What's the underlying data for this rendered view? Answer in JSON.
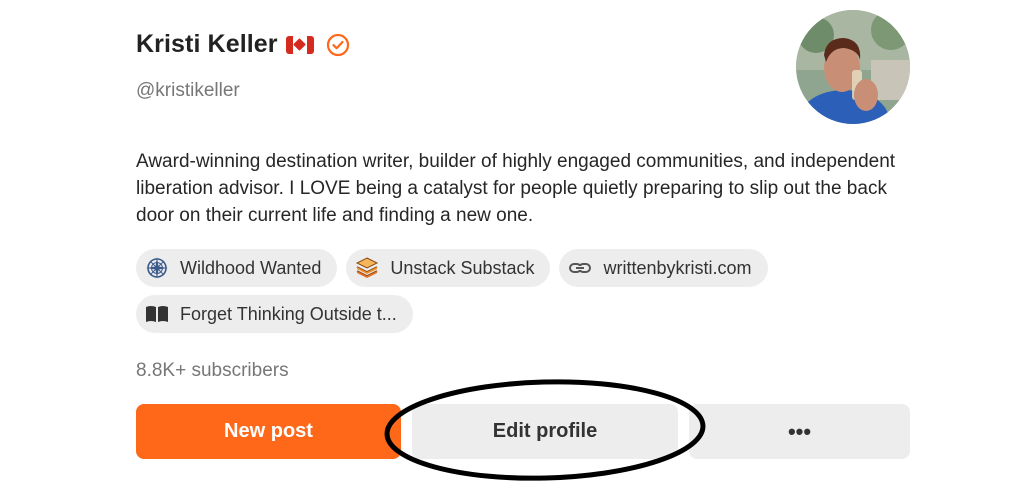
{
  "profile": {
    "name": "Kristi Keller",
    "flag": "🇨🇦",
    "handle": "@kristikeller",
    "bio": "Award-winning destination writer, builder of highly engaged communities, and independent liberation advisor. I LOVE being a catalyst for people quietly preparing to slip out the back door on their current life and finding a new one.",
    "subscribers": "8.8K+ subscribers"
  },
  "links": [
    {
      "label": "Wildhood Wanted",
      "icon": "compass-icon"
    },
    {
      "label": "Unstack Substack",
      "icon": "stack-icon"
    },
    {
      "label": "writtenbykristi.com",
      "icon": "link-icon"
    },
    {
      "label": "Forget Thinking Outside t...",
      "icon": "book-icon"
    }
  ],
  "actions": {
    "new_post": "New post",
    "edit_profile": "Edit profile",
    "more": "•••"
  },
  "colors": {
    "accent": "#ff6719",
    "verified": "#ff6719",
    "pill_bg": "#ededed"
  }
}
